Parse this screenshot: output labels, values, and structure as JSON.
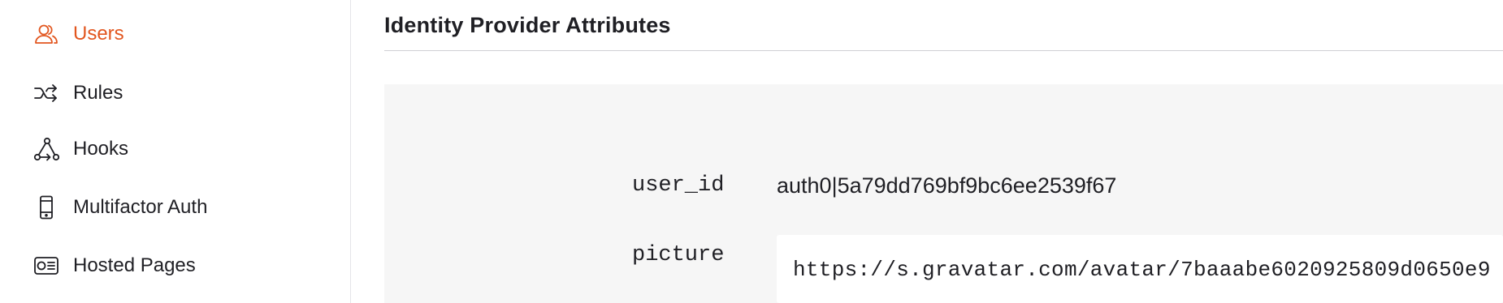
{
  "colors": {
    "accent": "#e2561f",
    "text": "#1f1f24",
    "panel_bg": "#f6f6f6",
    "divider": "#cfcfd4"
  },
  "sidebar": {
    "items": [
      {
        "label": "Users",
        "icon": "users-icon",
        "active": true
      },
      {
        "label": "Rules",
        "icon": "shuffle-icon",
        "active": false
      },
      {
        "label": "Hooks",
        "icon": "hooks-icon",
        "active": false
      },
      {
        "label": "Multifactor Auth",
        "icon": "mobile-phone-icon",
        "active": false
      },
      {
        "label": "Hosted Pages",
        "icon": "id-card-icon",
        "active": false
      }
    ]
  },
  "main": {
    "section_title": "Identity Provider Attributes",
    "attributes": [
      {
        "key": "user_id",
        "value": "auth0|5a79dd769bf9bc6ee2539f67"
      },
      {
        "key": "picture",
        "value": "https://s.gravatar.com/avatar/7baaabe6020925809d0650e9"
      }
    ]
  }
}
